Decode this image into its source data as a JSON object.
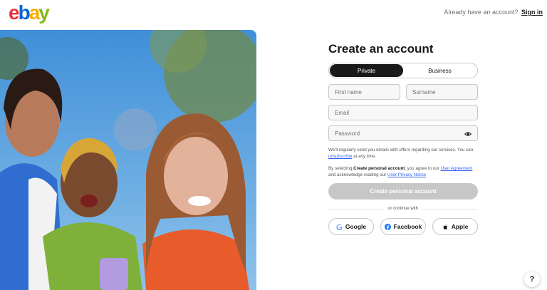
{
  "header": {
    "logo_letters": [
      "e",
      "b",
      "a",
      "y"
    ],
    "logo_colors": [
      "#e53238",
      "#0064d2",
      "#f5af02",
      "#86b817"
    ],
    "signin_prompt": "Already have an account?",
    "signin_link": "Sign in"
  },
  "hero": {
    "image": "photo of four smiling friends outdoors"
  },
  "form": {
    "title": "Create an account",
    "account_types": [
      "Private",
      "Business"
    ],
    "selected_account_type": "Private",
    "first_name_placeholder": "First name",
    "surname_placeholder": "Surname",
    "email_placeholder": "Email",
    "password_placeholder": "Password",
    "password_icon": "eye-icon",
    "email_note": "We'll regularly send you emails with offers regarding our services. You can",
    "unsubscribe_link": "unsubscribe",
    "email_note_end": "at any time.",
    "agreement_prefix": "By selecting",
    "agreement_bold": "Create personal account",
    "agreement_mid": ", you agree to our",
    "user_agreement_link": "User Agreement",
    "agreement_and": "and acknowledge reading our",
    "privacy_link": "User Privacy Notice",
    "submit_label": "Create personal account",
    "divider_text": "or continue with",
    "social": [
      {
        "label": "Google",
        "icon": "google-icon"
      },
      {
        "label": "Facebook",
        "icon": "facebook-icon"
      },
      {
        "label": "Apple",
        "icon": "apple-icon"
      }
    ]
  },
  "help_label": "?",
  "colors": {
    "primary": "#191919",
    "link": "#3665f3",
    "disabled": "#c7c7c7"
  }
}
